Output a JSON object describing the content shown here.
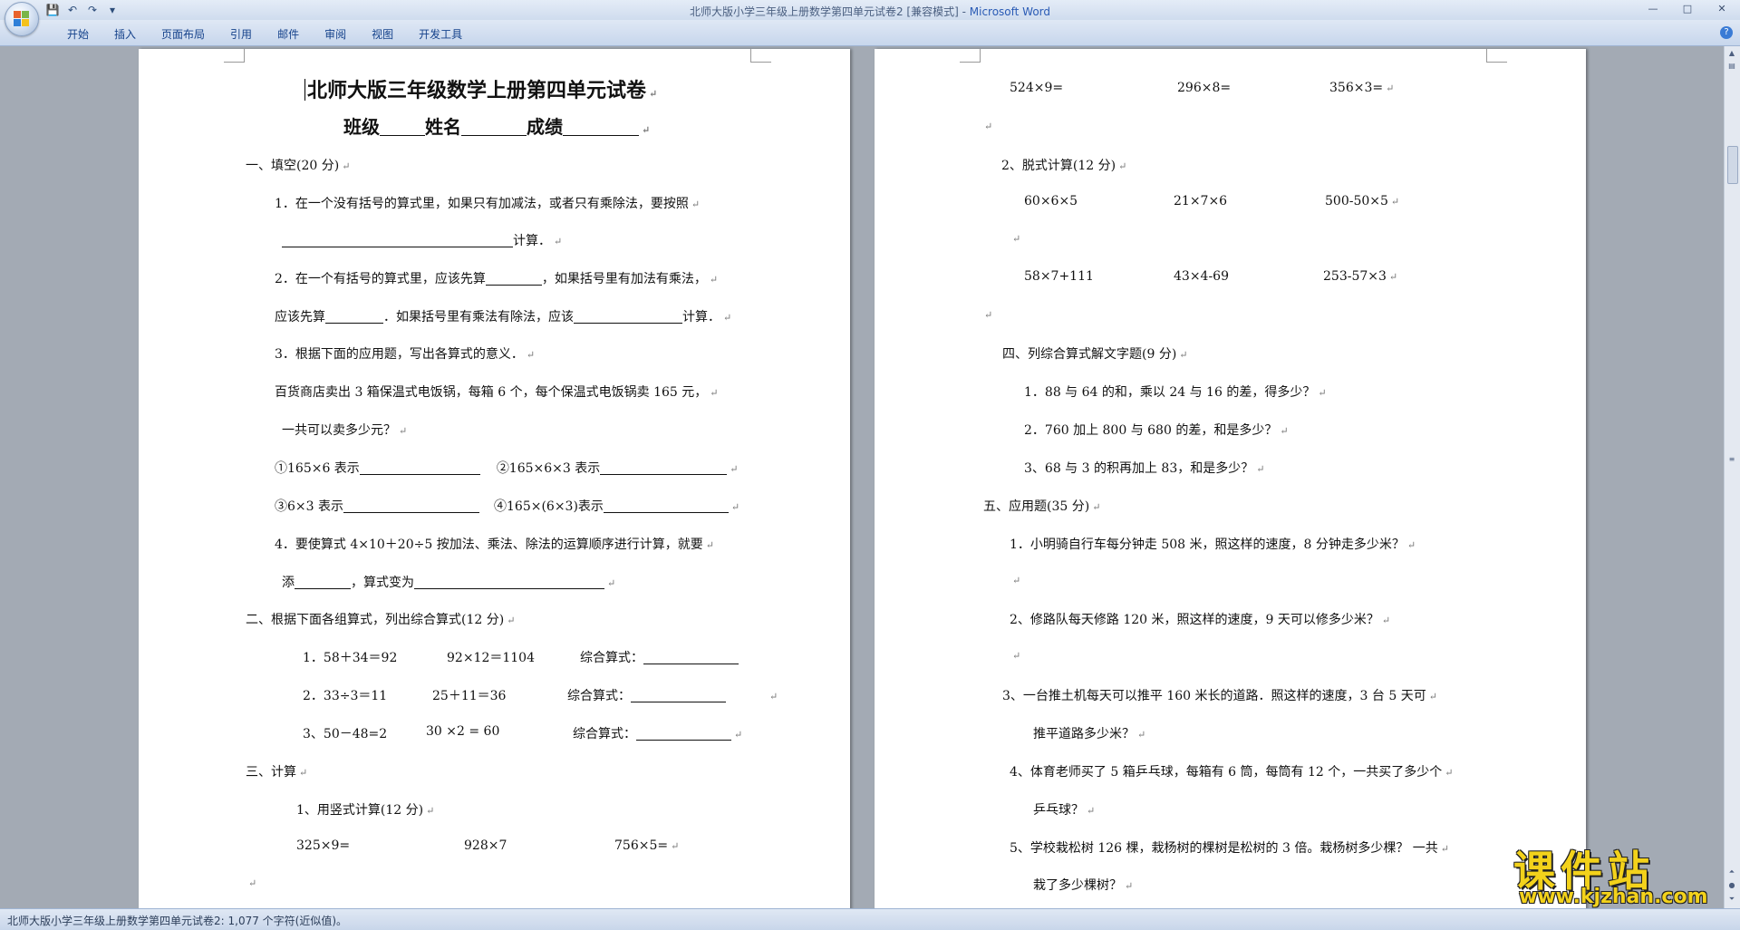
{
  "window": {
    "title": "北师大版小学三年级上册数学第四单元试卷2 [兼容模式] - ",
    "app_name": "Microsoft Word",
    "controls": [
      "—",
      "□",
      "✕"
    ]
  },
  "ribbon": {
    "tabs": [
      "开始",
      "插入",
      "页面布局",
      "引用",
      "邮件",
      "审阅",
      "视图",
      "开发工具"
    ],
    "help": "?"
  },
  "qat": {
    "save": "💾",
    "undo": "↶",
    "redo": "↷",
    "more": "▾"
  },
  "status": {
    "text": "北师大版小学三年级上册数学第四单元试卷2: 1,077 个字符(近似值)。"
  },
  "watermark": {
    "title": "课件站",
    "url": "www.kjzhan.com"
  },
  "page1": {
    "title": "北师大版三年级数学上册第四单元试卷",
    "sub": {
      "a": "班级",
      "b": "姓名",
      "c": "成绩"
    },
    "s1": "一、填空(20 分)",
    "q1a": "1．在一个没有括号的算式里，如果只有加减法，或者只有乘除法，要按照",
    "q1b": "计算．",
    "q2a_1": "2．在一个有括号的算式里，应该先算",
    "q2a_2": "，如果括号里有加法有乘法，",
    "q2b_1": "应该先算",
    "q2b_2": "．如果括号里有乘法有除法，应该",
    "q2b_3": "计算．",
    "q3": "3．根据下面的应用题，写出各算式的意义．",
    "q3t1": "百货商店卖出 3 箱保温式电饭锅，每箱 6 个，每个保温式电饭锅卖 165 元，",
    "q3t2": "一共可以卖多少元？",
    "e1": "①165×6 表示",
    "e2": "②165×6×3 表示",
    "e3": "③6×3 表示",
    "e4": "④165×(6×3)表示",
    "q4a": "4．要使算式 4×10＋20÷5 按加法、乘法、除法的运算顺序进行计算，就要",
    "q4b_1": "添",
    "q4b_2": "，算式变为",
    "s2": "二、根据下面各组算式，列出综合算式(12 分)",
    "g1a": "1．58＋34＝92",
    "g1b": "92×12＝1104",
    "g2a": "2．33÷3＝11",
    "g2b": "25＋11＝36",
    "g3a": "3、50－48=2",
    "g3b": "30 ×2 = 60",
    "zh": "综合算式：",
    "s3": "三、计算",
    "c1": "1、用竖式计算(12 分)",
    "v1": "325×9=",
    "v2": "928×7",
    "v3": "756×5="
  },
  "page2": {
    "v4": "524×9=",
    "v5": "296×8=",
    "v6": "356×3=",
    "c2": "2、脱式计算(12 分)",
    "t1": "60×6×5",
    "t2": "21×7×6",
    "t3": "500-50×5",
    "t4": "58×7+111",
    "t5": "43×4-69",
    "t6": "253-57×3",
    "s4": "四、列综合算式解文字题(9 分)",
    "w1": "1．88 与 64 的和，乘以 24 与 16 的差，得多少？",
    "w2": "2．760 加上 800 与 680 的差，和是多少？",
    "w3": "3、68 与 3 的积再加上 83，和是多少？",
    "s5": "五、应用题(35 分)",
    "a1": "1．小明骑自行车每分钟走 508 米，照这样的速度，8 分钟走多少米？",
    "a2": "2、修路队每天修路 120 米，照这样的速度，9 天可以修多少米？",
    "a3a": "3、一台推土机每天可以推平 160 米长的道路．照这样的速度，3 台 5 天可",
    "a3b": "推平道路多少米？",
    "a4a": "4、体育老师买了 5 箱乒乓球，每箱有 6 筒，每筒有 12 个，一共买了多少个",
    "a4b": "乒乓球？",
    "a5a": "5、学校栽松树 126 棵，栽杨树的棵树是松树的 3 倍。栽杨树多少棵？ 一共",
    "a5b": "栽了多少棵树？"
  }
}
